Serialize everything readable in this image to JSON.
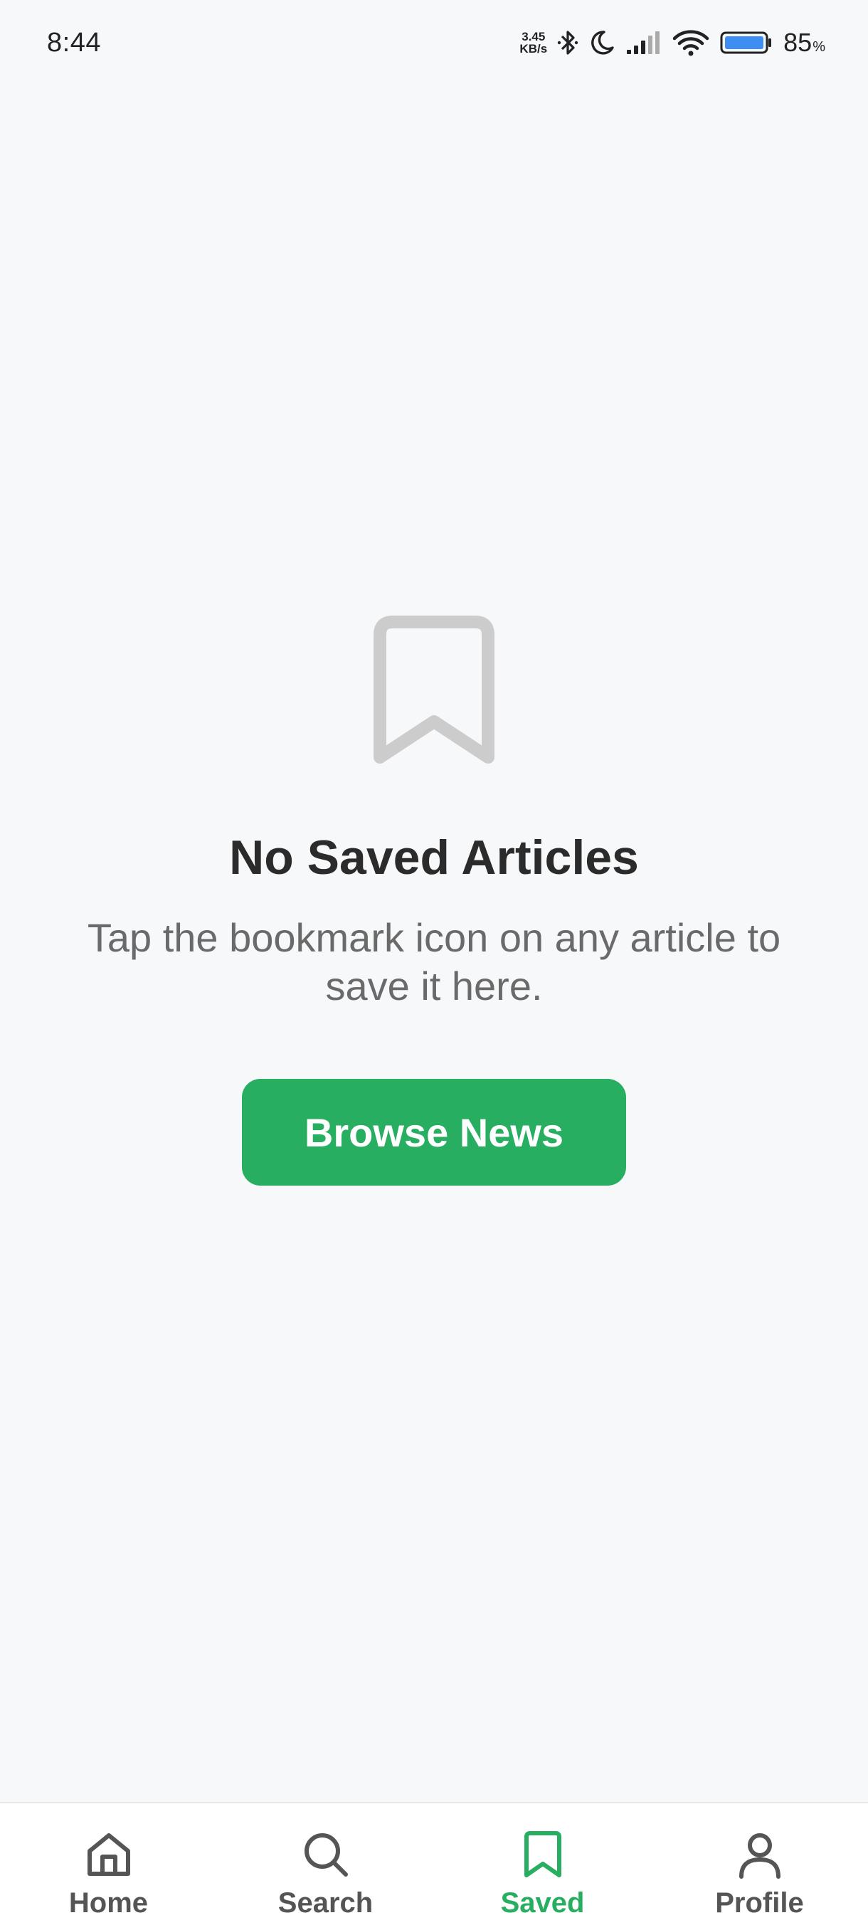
{
  "status_bar": {
    "time": "8:44",
    "net_speed_value": "3.45",
    "net_speed_unit": "KB/s",
    "battery_percent": "85",
    "battery_sign": "%",
    "icons": [
      "bluetooth-icon",
      "moon-icon",
      "signal-icon",
      "wifi-icon",
      "battery-icon"
    ]
  },
  "empty_state": {
    "icon": "bookmark-icon",
    "title": "No Saved Articles",
    "message": "Tap the bookmark icon on any article to save it here.",
    "button_label": "Browse News"
  },
  "bottom_nav": {
    "items": [
      {
        "label": "Home",
        "icon": "home-icon",
        "active": false
      },
      {
        "label": "Search",
        "icon": "search-icon",
        "active": false
      },
      {
        "label": "Saved",
        "icon": "bookmark-icon",
        "active": true
      },
      {
        "label": "Profile",
        "icon": "profile-icon",
        "active": false
      }
    ]
  },
  "colors": {
    "accent": "#27ae60",
    "background": "#f7f8fa",
    "title": "#2b2b2b",
    "message": "#6a6a6a",
    "inactive_nav": "#555555",
    "empty_icon": "#cccccc"
  }
}
